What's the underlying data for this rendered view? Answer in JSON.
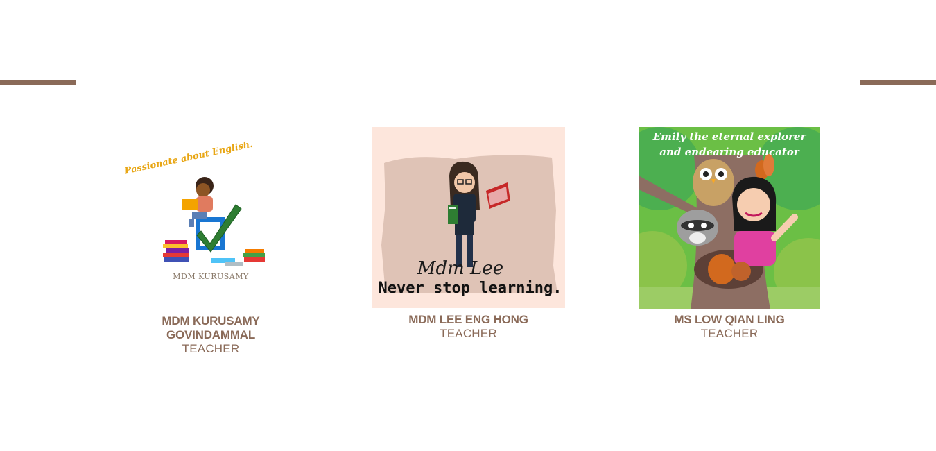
{
  "teachers": [
    {
      "name": "MDM KURUSAMY GOVINDAMMAL",
      "role": "TEACHER",
      "image": {
        "motto": "Passionate about English.",
        "caption": "MDM KURUSAMY"
      }
    },
    {
      "name": "MDM LEE ENG HONG",
      "role": "TEACHER",
      "image": {
        "signature": "Mdm Lee",
        "motto": "Never stop learning."
      }
    },
    {
      "name": "MS LOW QIAN LING",
      "role": "TEACHER",
      "image": {
        "title_line1": "Emily the eternal explorer",
        "title_line2": "and endearing educator"
      }
    }
  ]
}
